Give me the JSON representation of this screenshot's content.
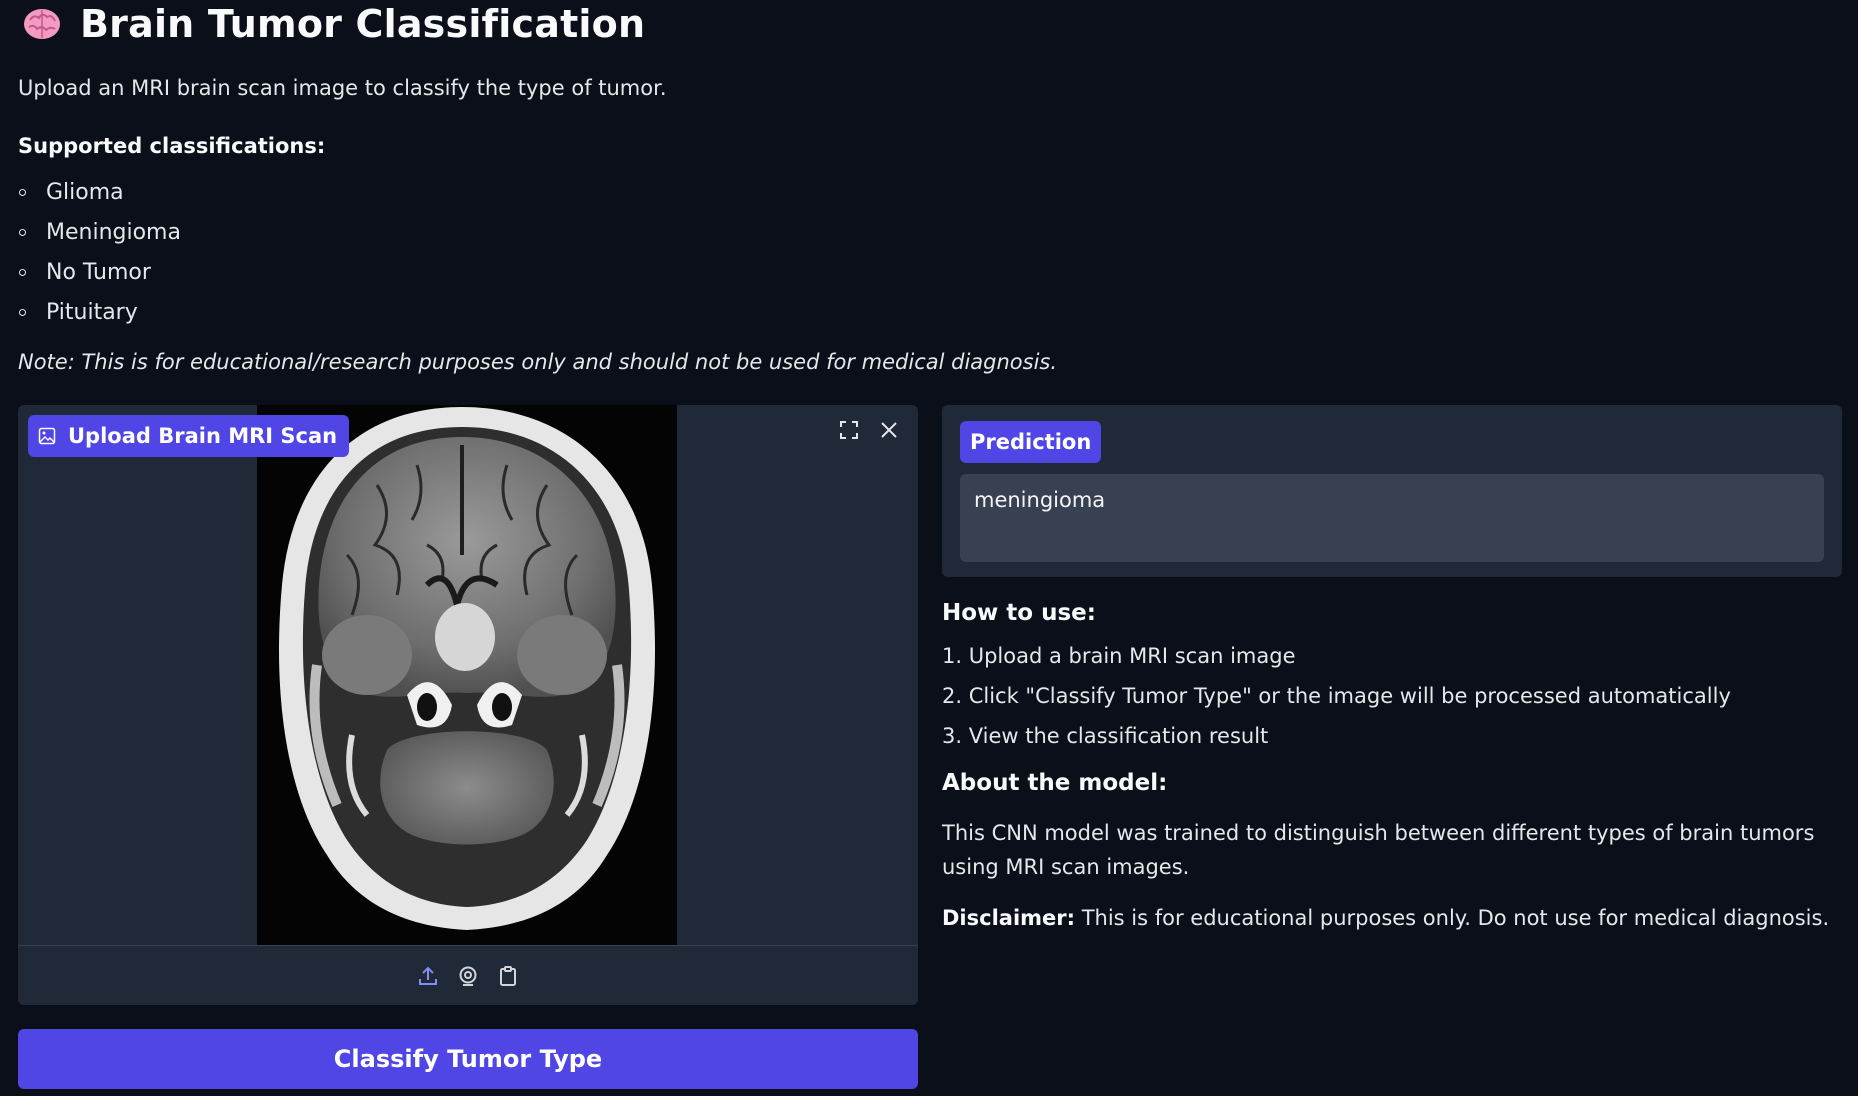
{
  "header": {
    "icon": "brain-icon",
    "title": "Brain Tumor Classification"
  },
  "intro": "Upload an MRI brain scan image to classify the type of tumor.",
  "supported": {
    "heading": "Supported classifications:",
    "items": [
      "Glioma",
      "Meningioma",
      "No Tumor",
      "Pituitary"
    ]
  },
  "note": "Note: This is for educational/research purposes only and should not be used for medical diagnosis.",
  "upload": {
    "label": "Upload Brain MRI Scan",
    "label_icon": "image-icon",
    "actions": [
      "fullscreen-icon",
      "close-icon"
    ],
    "toolbar": [
      "upload-icon",
      "webcam-icon",
      "clipboard-icon"
    ]
  },
  "classify_button": "Classify Tumor Type",
  "prediction": {
    "label": "Prediction",
    "value": "meningioma"
  },
  "how_to": {
    "heading": "How to use:",
    "steps": [
      "1. Upload a brain MRI scan image",
      "2. Click \"Classify Tumor Type\" or the image will be processed automatically",
      "3. View the classification result"
    ]
  },
  "about": {
    "heading": "About the model:",
    "text": "This CNN model was trained to distinguish between different types of brain tumors using MRI scan images.",
    "disclaimer_label": "Disclaimer:",
    "disclaimer_text": " This is for educational purposes only. Do not use for medical diagnosis."
  },
  "colors": {
    "background": "#0b0f19",
    "panel": "#1f2937",
    "accent": "#4f46e5",
    "input": "#374151"
  }
}
